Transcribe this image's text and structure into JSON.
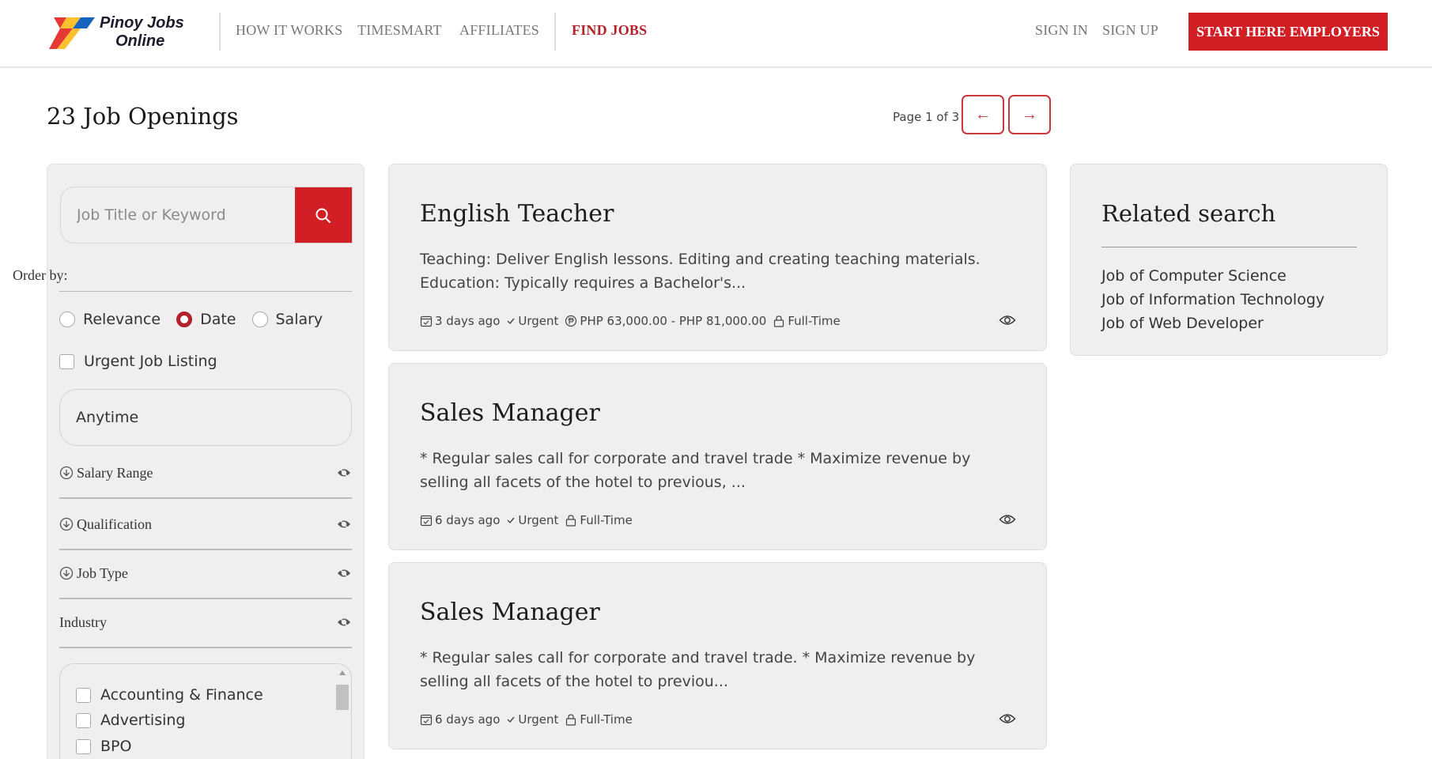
{
  "brand": {
    "line1": "Pinoy Jobs",
    "line2": "Online"
  },
  "nav": {
    "how_it_works": "HOW IT WORKS",
    "timesmart": "TIMESMART",
    "affiliates": "AFFILIATES",
    "find_jobs": "FIND JOBS",
    "sign_in": "SIGN IN",
    "sign_up": "SIGN UP",
    "cta": "START HERE EMPLOYERS"
  },
  "main": {
    "title": "23 Job Openings",
    "pager": {
      "text": "Page 1 of 3",
      "prev": "←",
      "next": "→"
    }
  },
  "filters": {
    "search_placeholder": "Job Title or Keyword",
    "order_label": "Order by:",
    "order_options": [
      "Relevance",
      "Date",
      "Salary"
    ],
    "order_selected": "Date",
    "urgent_label": "Urgent Job Listing",
    "anytime": "Anytime",
    "salary_range": "Salary Range",
    "qualification": "Qualification",
    "job_type": "Job Type",
    "industry": "Industry",
    "industries": [
      "Accounting & Finance",
      "Advertising",
      "BPO"
    ]
  },
  "jobs": [
    {
      "title": "English Teacher",
      "desc": "Teaching: Deliver  English lessons. Editing and creating teaching materials. Education: Typically requires a Bachelor's...",
      "posted": "3 days ago",
      "urgent": "Urgent",
      "salary": "PHP 63,000.00 - PHP 81,000.00",
      "type": "Full-Time"
    },
    {
      "title": "Sales Manager",
      "desc": "* Regular sales call for corporate and travel trade * Maximize revenue by selling all facets of the hotel to previous, ...",
      "posted": "6 days ago",
      "urgent": "Urgent",
      "type": "Full-Time"
    },
    {
      "title": "Sales Manager",
      "desc": "* Regular sales call for corporate and travel trade.  * Maximize revenue by selling all facets of the hotel to previou...",
      "posted": "6 days ago",
      "urgent": "Urgent",
      "type": "Full-Time"
    }
  ],
  "related": {
    "title": "Related search",
    "links": [
      "Job of Computer Science",
      "Job of Information Technology",
      "Job of Web Developer"
    ]
  },
  "colors": {
    "brand_red": "#d21f26",
    "active_nav": "#b3222a",
    "card_bg": "#efefef"
  }
}
